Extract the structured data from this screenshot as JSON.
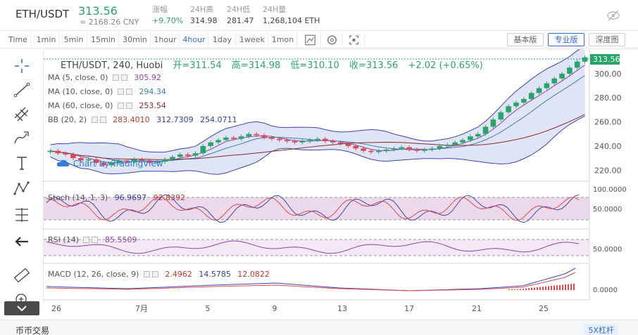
{
  "header": {
    "pair": "ETH/USDT",
    "last_price": "313.56",
    "cny_price": "≈ 2168.26 CNY",
    "stats": [
      {
        "label": "涨幅",
        "value": "+9.70%",
        "up": true
      },
      {
        "label": "24H高",
        "value": "314.98",
        "up": false
      },
      {
        "label": "24H低",
        "value": "281.47",
        "up": false
      },
      {
        "label": "24H量",
        "value": "1,268,104 ETH",
        "up": false
      }
    ]
  },
  "toolbar": {
    "timeframes": [
      "Time",
      "1min",
      "5min",
      "15min",
      "30min",
      "1hour",
      "4hour",
      "1day",
      "1week",
      "1mon"
    ],
    "active_timeframe": "4hour",
    "basic_version": "基本版",
    "pro_version": "专业版",
    "depth_chart": "深度图"
  },
  "legend": {
    "title": {
      "symbol": "ETH/USDT, 240, Huobi",
      "open": "开=311.54",
      "high": "高=314.98",
      "low": "低=310.10",
      "close": "收=313.56",
      "change": "+2.02 (+0.65%)"
    },
    "ma5": {
      "label": "MA (5, close, 0)",
      "value": "305.92",
      "color": "#8e44ad"
    },
    "ma10": {
      "label": "MA (10, close, 0)",
      "value": "294.34",
      "color": "#3d7fb5"
    },
    "ma60": {
      "label": "MA (60, close, 0)",
      "value": "253.54",
      "color": "#8b2a2a"
    },
    "bb": {
      "label": "BB (20, 2)",
      "v1": "283.4010",
      "v2": "312.7309",
      "v3": "254.0711"
    },
    "stoch": {
      "label": "Stoch (14, 1, 3)",
      "v1": "96.9697",
      "v2": "92.8392"
    },
    "rsi": {
      "label": "RSI (14)",
      "value": "85.5509"
    },
    "macd": {
      "label": "MACD (12, 26, close, 9)",
      "v1": "2.4962",
      "v2": "14.5785",
      "v3": "12.0822"
    }
  },
  "watermark": "Chart by TradingView",
  "price_axis": [
    "300.00",
    "280.00",
    "260.00",
    "240.00",
    "220.00"
  ],
  "price_label": "313.56",
  "stoch_axis": [
    "100.0000",
    "50.0000"
  ],
  "rsi_axis": [
    "50.0000"
  ],
  "macd_axis": [
    "0.0000"
  ],
  "date_axis": [
    "26",
    "7月",
    "5",
    "9",
    "13",
    "17",
    "21",
    "25"
  ],
  "bottom": {
    "left": "币币交易",
    "right": "5X杠杆"
  },
  "colors": {
    "up": "#2aa56a",
    "down": "#e0494a",
    "accent": "#2f6bd6"
  },
  "chart_data": {
    "type": "candlestick",
    "title": "ETH/USDT, 240, Huobi",
    "ylim": [
      212,
      318
    ],
    "series": [
      {
        "name": "close",
        "values": [
          236,
          234,
          233,
          230,
          228,
          229,
          226,
          224,
          226,
          228,
          227,
          229,
          228,
          226,
          227,
          229,
          231,
          233,
          232,
          234,
          240,
          243,
          245,
          247,
          246,
          248,
          250,
          249,
          247,
          246,
          245,
          244,
          243,
          244,
          245,
          246,
          244,
          243,
          242,
          240,
          238,
          236,
          235,
          236,
          237,
          238,
          239,
          237,
          236,
          237,
          238,
          240,
          241,
          243,
          245,
          248,
          250,
          256,
          262,
          268,
          273,
          276,
          279,
          284,
          288,
          292,
          296,
          300,
          305,
          310,
          313.56
        ]
      }
    ]
  }
}
